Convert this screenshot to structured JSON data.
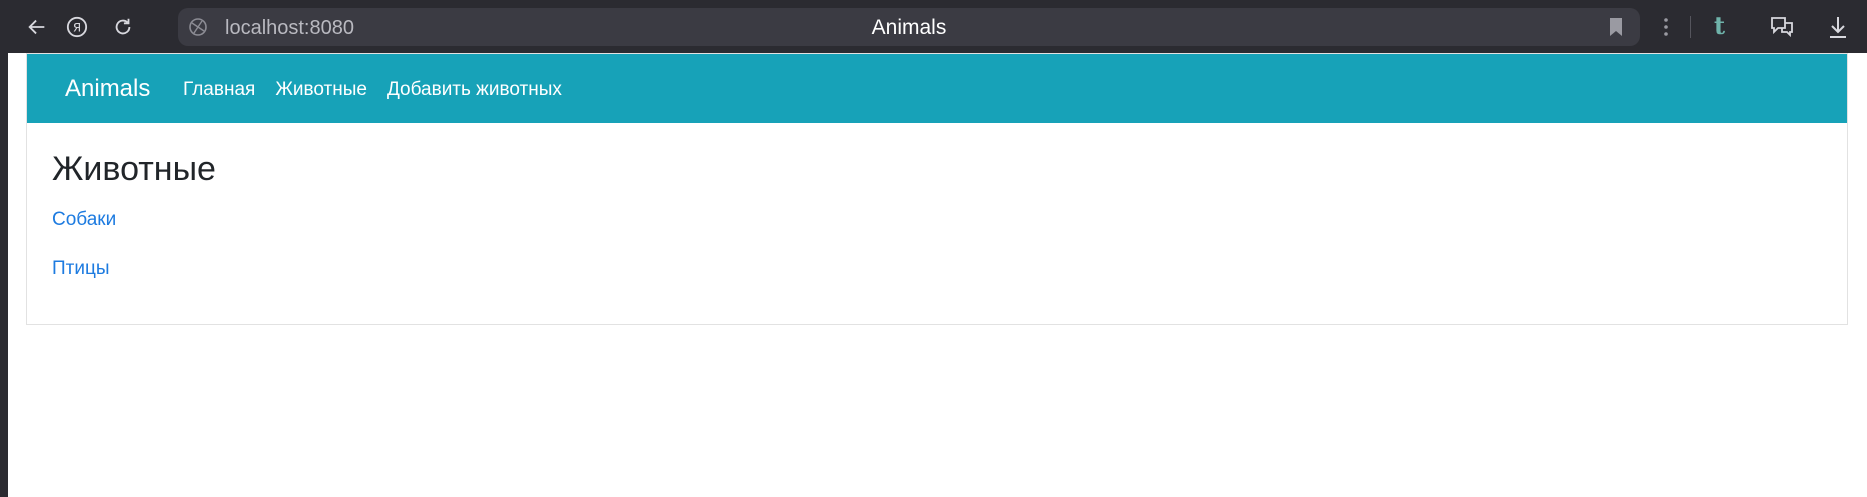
{
  "browser": {
    "url": "localhost:8080",
    "title": "Animals",
    "extension_label": "t"
  },
  "site": {
    "brand": "Animals",
    "nav": [
      {
        "label": "Главная"
      },
      {
        "label": "Животные"
      },
      {
        "label": "Добавить животных"
      }
    ]
  },
  "main": {
    "heading": "Животные",
    "links": [
      {
        "label": "Собаки"
      },
      {
        "label": "Птицы"
      }
    ]
  },
  "colors": {
    "browser_bar": "#2b2b31",
    "navbar": "#17a2b8",
    "link": "#1d7be0"
  }
}
